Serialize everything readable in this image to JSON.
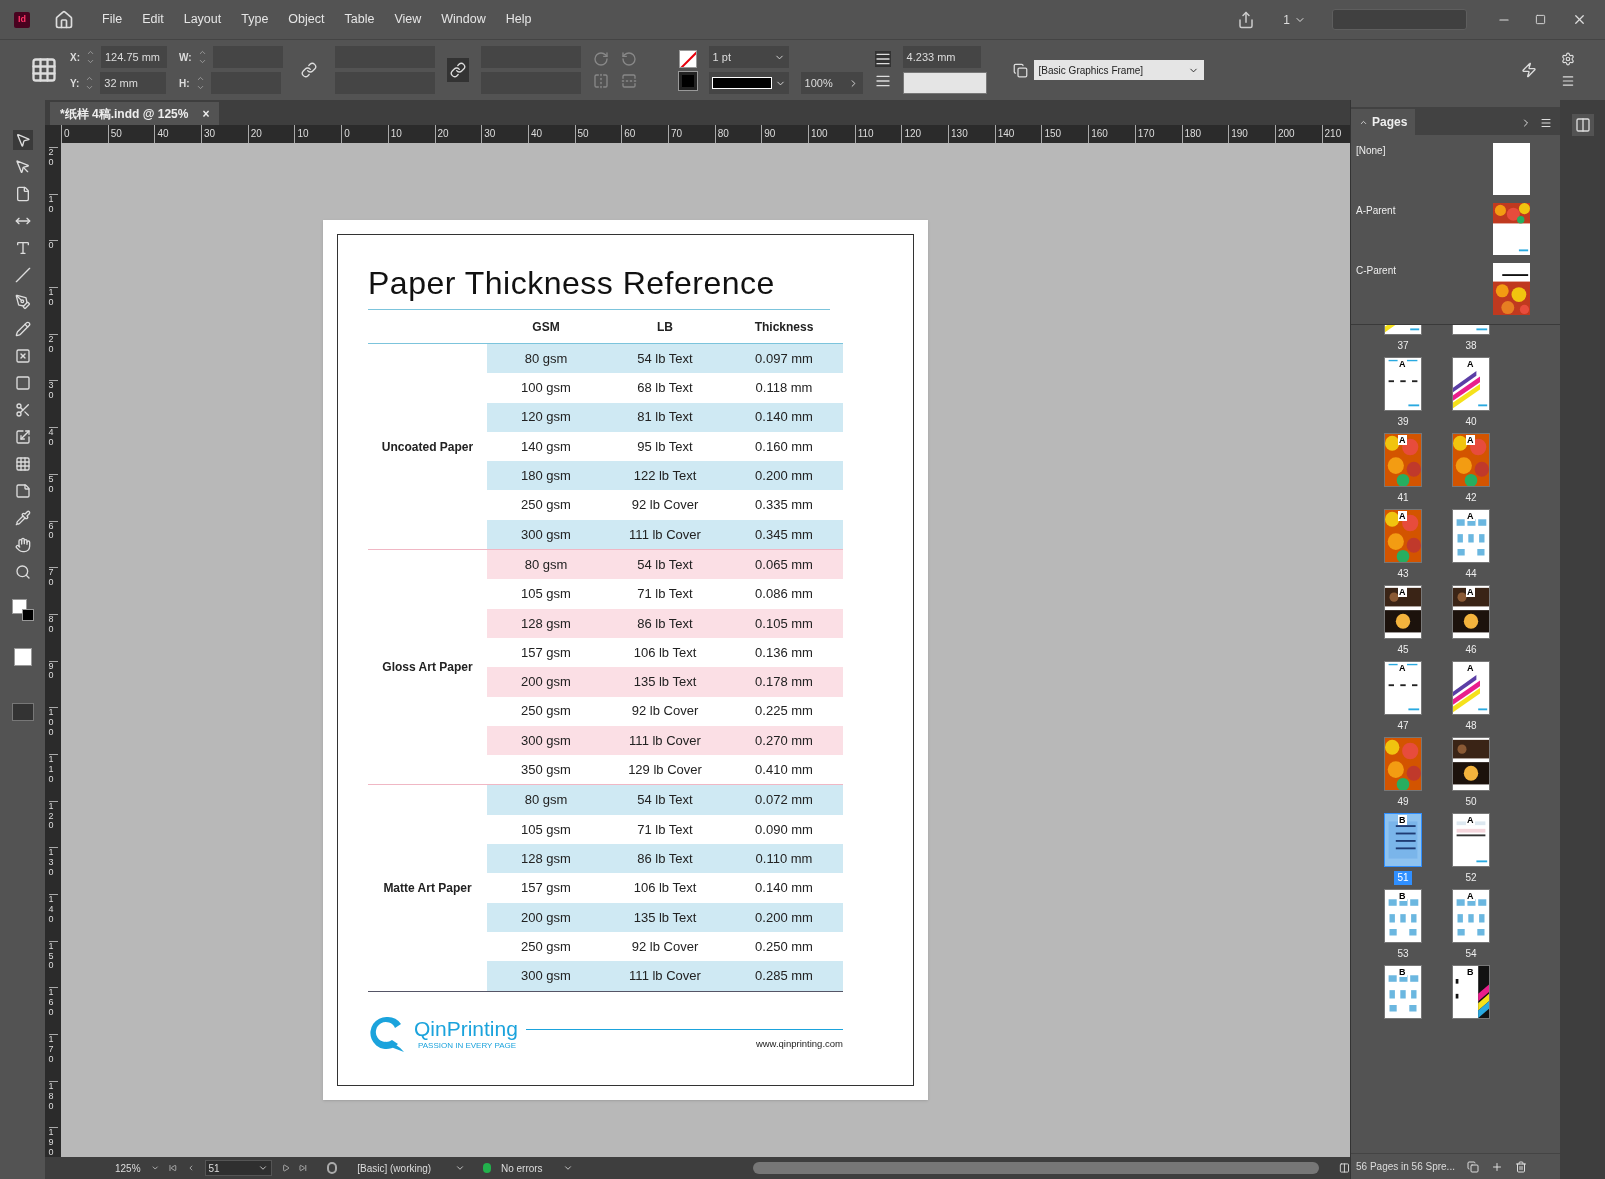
{
  "menu": [
    "File",
    "Edit",
    "Layout",
    "Type",
    "Object",
    "Table",
    "View",
    "Window",
    "Help"
  ],
  "app_logo": "Id",
  "top_right": {
    "page_number": "1"
  },
  "control_panel": {
    "x_label": "X:",
    "x": "124.75 mm",
    "y_label": "Y:",
    "y": "32 mm",
    "w_label": "W:",
    "h_label": "H:",
    "stroke_weight": "1 pt",
    "opacity": "100%",
    "spacing": "4.233 mm",
    "object_style": "[Basic Graphics Frame]"
  },
  "document_tab": {
    "title": "*纸样 4稿.indd @ 125%",
    "close": "×"
  },
  "ruler_h": [
    "0",
    "50",
    "40",
    "30",
    "20",
    "10",
    "0",
    "10",
    "20",
    "30",
    "40",
    "50",
    "60",
    "70",
    "80",
    "90",
    "100",
    "110",
    "120",
    "130",
    "140",
    "150",
    "160",
    "170",
    "180",
    "190",
    "200",
    "210"
  ],
  "ruler_v": [
    "20",
    "10",
    "0",
    "10",
    "20",
    "30",
    "40",
    "50",
    "60",
    "70",
    "80",
    "90",
    "100",
    "110",
    "120",
    "130",
    "140",
    "150",
    "160",
    "170",
    "180",
    "190"
  ],
  "document": {
    "title": "Paper Thickness Reference",
    "columns": [
      "GSM",
      "LB",
      "Thickness"
    ],
    "groups": [
      {
        "label": "Uncoated Paper",
        "color": "#cfe9f3",
        "rows": [
          [
            "80 gsm",
            "54 lb Text",
            "0.097 mm"
          ],
          [
            "100 gsm",
            "68 lb Text",
            "0.118 mm"
          ],
          [
            "120 gsm",
            "81 lb Text",
            "0.140 mm"
          ],
          [
            "140 gsm",
            "95 lb Text",
            "0.160 mm"
          ],
          [
            "180 gsm",
            "122 lb Text",
            "0.200 mm"
          ],
          [
            "250 gsm",
            "92 lb Cover",
            "0.335 mm"
          ],
          [
            "300 gsm",
            "111 lb Cover",
            "0.345 mm"
          ]
        ]
      },
      {
        "label": "Gloss Art Paper",
        "color": "#fbdfe5",
        "rows": [
          [
            "80 gsm",
            "54 lb Text",
            "0.065 mm"
          ],
          [
            "105 gsm",
            "71 lb Text",
            "0.086 mm"
          ],
          [
            "128 gsm",
            "86 lb Text",
            "0.105 mm"
          ],
          [
            "157 gsm",
            "106 lb Text",
            "0.136 mm"
          ],
          [
            "200 gsm",
            "135 lb Text",
            "0.178 mm"
          ],
          [
            "250 gsm",
            "92 lb Cover",
            "0.225 mm"
          ],
          [
            "300 gsm",
            "111 lb Cover",
            "0.270 mm"
          ],
          [
            "350 gsm",
            "129 lb Cover",
            "0.410 mm"
          ]
        ]
      },
      {
        "label": "Matte Art Paper",
        "color": "#cfe9f3",
        "rows": [
          [
            "80 gsm",
            "54 lb Text",
            "0.072 mm"
          ],
          [
            "105 gsm",
            "71 lb Text",
            "0.090 mm"
          ],
          [
            "128 gsm",
            "86 lb Text",
            "0.110 mm"
          ],
          [
            "157 gsm",
            "106 lb Text",
            "0.140 mm"
          ],
          [
            "200 gsm",
            "135 lb Text",
            "0.200 mm"
          ],
          [
            "250 gsm",
            "92 lb Cover",
            "0.250 mm"
          ],
          [
            "300 gsm",
            "111 lb Cover",
            "0.285 mm"
          ]
        ]
      }
    ],
    "brand": "QinPrinting",
    "tagline": "PASSION IN EVERY PAGE",
    "url": "www.qinprinting.com"
  },
  "pages_panel": {
    "title": "Pages",
    "parents": [
      {
        "label": "[None]",
        "kind": "blank"
      },
      {
        "label": "A-Parent",
        "kind": "fruit-top"
      },
      {
        "label": "C-Parent",
        "kind": "fruit-bottom"
      }
    ],
    "pages": [
      {
        "number": "37",
        "kind": "stripes",
        "selected": false
      },
      {
        "number": "38",
        "kind": "dashes",
        "selected": false
      },
      {
        "number": "39",
        "parent": "A",
        "kind": "dashes",
        "selected": false
      },
      {
        "number": "40",
        "parent": "A",
        "kind": "stripes",
        "selected": false
      },
      {
        "number": "41",
        "parent": "A",
        "kind": "fruit",
        "selected": false
      },
      {
        "number": "42",
        "parent": "A",
        "kind": "fruit",
        "selected": false
      },
      {
        "number": "43",
        "parent": "A",
        "kind": "fruit",
        "selected": false
      },
      {
        "number": "44",
        "parent": "A",
        "kind": "diagram",
        "selected": false
      },
      {
        "number": "45",
        "parent": "A",
        "kind": "dark-photo",
        "selected": false
      },
      {
        "number": "46",
        "parent": "A",
        "kind": "dark-photo",
        "selected": false
      },
      {
        "number": "47",
        "parent": "A",
        "kind": "dashes",
        "selected": false
      },
      {
        "number": "48",
        "parent": "A",
        "kind": "stripes",
        "selected": false
      },
      {
        "number": "49",
        "kind": "fruit",
        "selected": false
      },
      {
        "number": "50",
        "kind": "dark-photo",
        "selected": false
      },
      {
        "number": "51",
        "parent": "B",
        "kind": "table-blue",
        "selected": true
      },
      {
        "number": "52",
        "parent": "A",
        "kind": "table",
        "selected": false
      },
      {
        "number": "53",
        "parent": "B",
        "kind": "diagram",
        "selected": false
      },
      {
        "number": "54",
        "parent": "A",
        "kind": "diagram",
        "selected": false
      },
      {
        "parent": "B",
        "kind": "diagram",
        "selected": false
      },
      {
        "parent": "B",
        "kind": "cmyk",
        "selected": false
      }
    ],
    "footer": "56 Pages in 56 Spre..."
  },
  "status_bar": {
    "zoom": "125%",
    "page": "51",
    "preflight_profile": "[Basic] (working)",
    "errors": "No errors"
  }
}
